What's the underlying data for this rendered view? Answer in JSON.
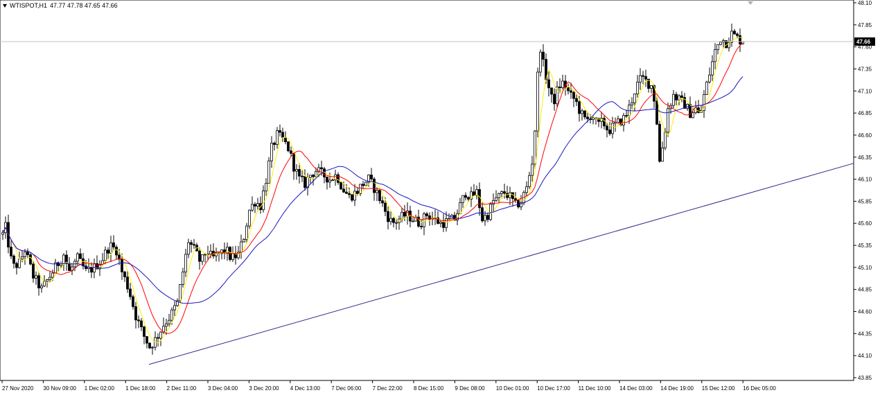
{
  "header": {
    "symbol": "WTISPOT,H1",
    "ohlc": "47.77 47.78 47.65 47.66"
  },
  "colors": {
    "background": "#ffffff",
    "candle": "#000000",
    "ma_fast": "#ffee00",
    "ma_mid": "#ff0000",
    "ma_slow": "#1515c0",
    "trendline": "#2a2a8a",
    "price_line": "#c0c0c0"
  },
  "chart_data": {
    "type": "candlestick",
    "symbol": "WTISPOT",
    "timeframe": "H1",
    "ylim": [
      43.85,
      48.1
    ],
    "y_ticks": [
      "48.10",
      "47.85",
      "47.60",
      "47.35",
      "47.10",
      "46.85",
      "46.60",
      "46.35",
      "46.10",
      "45.85",
      "45.60",
      "45.35",
      "45.10",
      "44.85",
      "44.60",
      "44.35",
      "44.10",
      "43.85"
    ],
    "x_ticks": [
      "27 Nov 2020",
      "30 Nov 09:00",
      "1 Dec 02:00",
      "1 Dec 18:00",
      "2 Dec 11:00",
      "3 Dec 04:00",
      "3 Dec 20:00",
      "4 Dec 13:00",
      "7 Dec 06:00",
      "7 Dec 22:00",
      "8 Dec 15:00",
      "9 Dec 08:00",
      "10 Dec 01:00",
      "10 Dec 17:00",
      "11 Dec 10:00",
      "14 Dec 03:00",
      "14 Dec 19:00",
      "15 Dec 12:00",
      "16 Dec 05:00"
    ],
    "current_price": "47.66",
    "approx_close_path": [
      [
        0,
        45.4
      ],
      [
        8,
        45.55
      ],
      [
        18,
        45.1
      ],
      [
        28,
        45.15
      ],
      [
        36,
        45.3
      ],
      [
        48,
        45.0
      ],
      [
        60,
        44.85
      ],
      [
        72,
        45.0
      ],
      [
        84,
        45.15
      ],
      [
        92,
        45.25
      ],
      [
        100,
        45.05
      ],
      [
        112,
        45.2
      ],
      [
        124,
        45.05
      ],
      [
        136,
        45.1
      ],
      [
        148,
        45.2
      ],
      [
        158,
        45.35
      ],
      [
        168,
        45.3
      ],
      [
        176,
        45.05
      ],
      [
        186,
        44.85
      ],
      [
        196,
        44.55
      ],
      [
        206,
        44.35
      ],
      [
        216,
        44.2
      ],
      [
        226,
        44.3
      ],
      [
        236,
        44.45
      ],
      [
        246,
        44.55
      ],
      [
        256,
        44.7
      ],
      [
        264,
        45.05
      ],
      [
        272,
        45.4
      ],
      [
        280,
        45.3
      ],
      [
        290,
        45.15
      ],
      [
        298,
        45.3
      ],
      [
        306,
        45.2
      ],
      [
        316,
        45.25
      ],
      [
        326,
        45.3
      ],
      [
        334,
        45.2
      ],
      [
        344,
        45.25
      ],
      [
        352,
        45.45
      ],
      [
        360,
        45.75
      ],
      [
        368,
        45.85
      ],
      [
        376,
        45.8
      ],
      [
        384,
        46.1
      ],
      [
        392,
        46.45
      ],
      [
        400,
        46.6
      ],
      [
        408,
        46.55
      ],
      [
        416,
        46.45
      ],
      [
        424,
        46.25
      ],
      [
        432,
        46.1
      ],
      [
        440,
        46.05
      ],
      [
        448,
        46.15
      ],
      [
        456,
        46.2
      ],
      [
        466,
        46.15
      ],
      [
        476,
        46.1
      ],
      [
        486,
        46.15
      ],
      [
        494,
        46.0
      ],
      [
        504,
        45.9
      ],
      [
        514,
        45.95
      ],
      [
        524,
        46.05
      ],
      [
        532,
        46.1
      ],
      [
        540,
        46.0
      ],
      [
        550,
        45.85
      ],
      [
        558,
        45.7
      ],
      [
        566,
        45.6
      ],
      [
        576,
        45.65
      ],
      [
        586,
        45.7
      ],
      [
        596,
        45.65
      ],
      [
        606,
        45.6
      ],
      [
        616,
        45.7
      ],
      [
        626,
        45.65
      ],
      [
        636,
        45.6
      ],
      [
        646,
        45.62
      ],
      [
        656,
        45.65
      ],
      [
        664,
        45.8
      ],
      [
        672,
        45.95
      ],
      [
        680,
        45.9
      ],
      [
        688,
        45.95
      ],
      [
        696,
        45.65
      ],
      [
        704,
        45.7
      ],
      [
        712,
        45.85
      ],
      [
        720,
        45.9
      ],
      [
        728,
        45.95
      ],
      [
        736,
        45.9
      ],
      [
        744,
        45.8
      ],
      [
        752,
        45.85
      ],
      [
        760,
        46.0
      ],
      [
        768,
        46.3
      ],
      [
        774,
        46.85
      ],
      [
        778,
        47.7
      ],
      [
        784,
        47.4
      ],
      [
        790,
        47.2
      ],
      [
        798,
        46.95
      ],
      [
        806,
        47.15
      ],
      [
        814,
        47.2
      ],
      [
        822,
        47.05
      ],
      [
        830,
        47.0
      ],
      [
        838,
        46.85
      ],
      [
        846,
        46.75
      ],
      [
        854,
        46.85
      ],
      [
        862,
        46.7
      ],
      [
        870,
        46.75
      ],
      [
        878,
        46.65
      ],
      [
        886,
        46.7
      ],
      [
        894,
        46.75
      ],
      [
        902,
        46.8
      ],
      [
        910,
        46.95
      ],
      [
        918,
        47.15
      ],
      [
        926,
        47.25
      ],
      [
        934,
        47.2
      ],
      [
        942,
        47.15
      ],
      [
        948,
        46.75
      ],
      [
        952,
        46.3
      ],
      [
        958,
        46.55
      ],
      [
        964,
        46.9
      ],
      [
        972,
        47.05
      ],
      [
        980,
        47.0
      ],
      [
        988,
        46.95
      ],
      [
        996,
        46.85
      ],
      [
        1004,
        46.9
      ],
      [
        1010,
        46.8
      ],
      [
        1016,
        47.05
      ],
      [
        1024,
        47.3
      ],
      [
        1032,
        47.55
      ],
      [
        1040,
        47.7
      ],
      [
        1048,
        47.65
      ],
      [
        1056,
        47.75
      ],
      [
        1064,
        47.7
      ],
      [
        1072,
        47.66
      ]
    ],
    "trendline": {
      "from": [
        "1 Dec 18:00",
        44.0
      ],
      "to": [
        "right edge",
        46.28
      ]
    }
  }
}
